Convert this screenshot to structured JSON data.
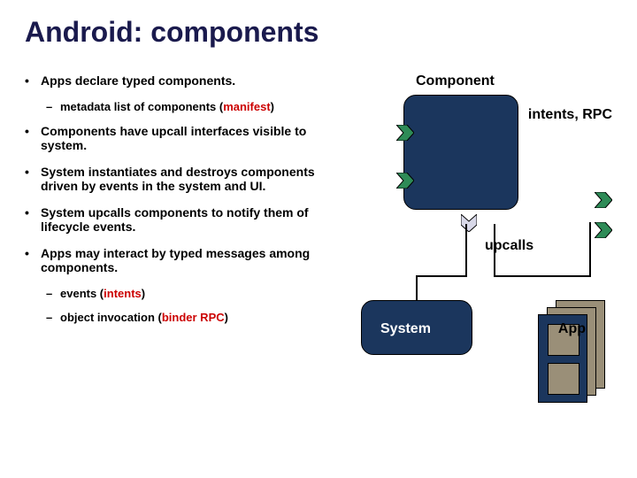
{
  "title": "Android: components",
  "bullets": {
    "b1": "Apps declare typed components.",
    "b1s1_pre": "metadata list of components (",
    "b1s1_hl": "manifest",
    "b1s1_post": ")",
    "b2": "Components have upcall interfaces visible to system.",
    "b3": "System instantiates and destroys components driven by events in the system and UI.",
    "b4": "System upcalls components to notify them of lifecycle events.",
    "b5": "Apps may interact by typed messages among components.",
    "b5s1_pre": "events (",
    "b5s1_hl": "intents",
    "b5s1_post": ")",
    "b5s2_pre": "object invocation (",
    "b5s2_hl": "binder RPC",
    "b5s2_post": ")"
  },
  "diagram": {
    "component_label": "Component",
    "intents_label": "intents, RPC",
    "upcalls_label": "upcalls",
    "system_label": "System",
    "app_label": "App"
  },
  "glyphs": {
    "bullet": "•",
    "dash": "–"
  }
}
